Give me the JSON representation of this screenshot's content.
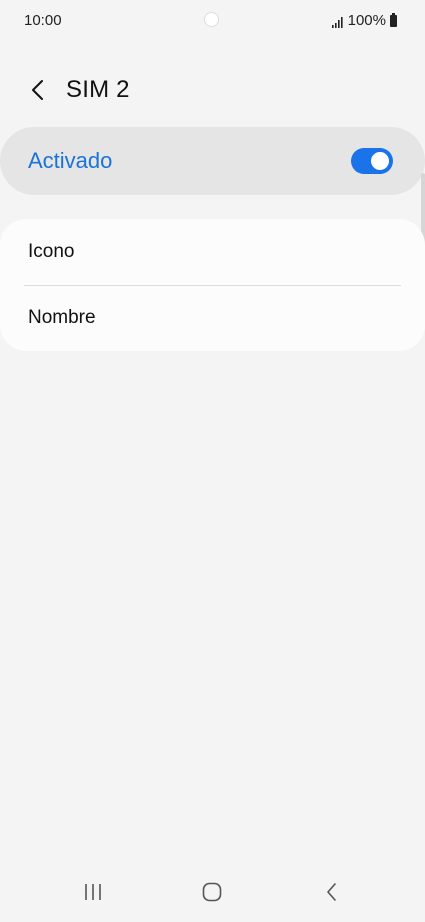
{
  "status_bar": {
    "time": "10:00",
    "battery": "100%"
  },
  "header": {
    "title": "SIM 2",
    "back_icon": "chevron-left-icon"
  },
  "master_switch": {
    "label": "Activado",
    "state": "on",
    "accent_color": "#1a73e8"
  },
  "settings": {
    "items": [
      {
        "label": "Icono"
      },
      {
        "label": "Nombre"
      }
    ]
  },
  "nav_bar": {
    "recents_icon": "recents-icon",
    "home_icon": "home-icon",
    "back_icon": "back-icon"
  }
}
